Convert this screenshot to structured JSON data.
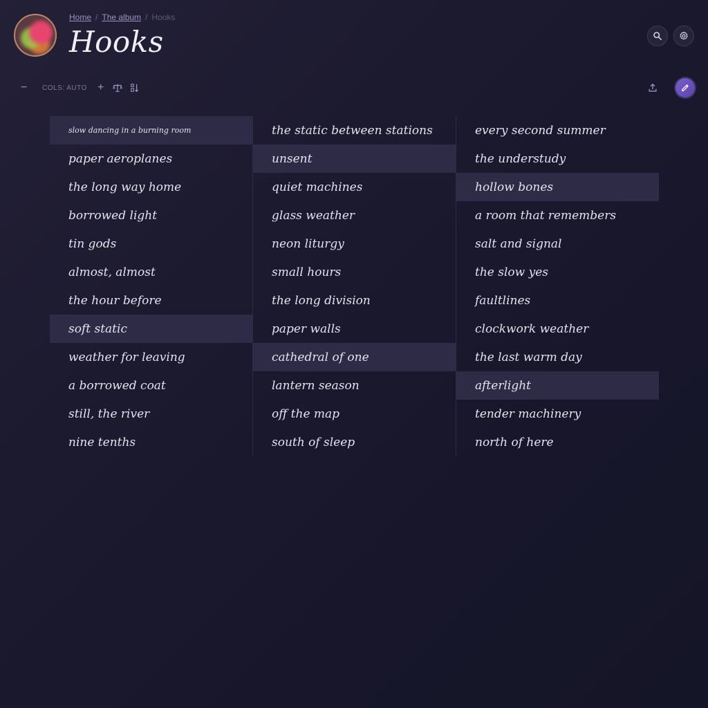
{
  "breadcrumb": {
    "home": "Home",
    "album": "The album",
    "current": "Hooks",
    "separator": "/"
  },
  "page_title": "Hooks",
  "toolbar": {
    "minus": "−",
    "cols_label": "COLS: AUTO",
    "plus": "+"
  },
  "icons": {
    "search": "search-icon",
    "settings": "gear-icon",
    "balance": "balance-icon",
    "sort": "sort-icon",
    "upload": "upload-icon",
    "edit": "pencil-icon"
  },
  "colors": {
    "accent": "#6a50c0",
    "highlight_row": "#2e2b47",
    "background": "#1c1a2e"
  },
  "columns": [
    {
      "items": [
        {
          "label": "slow dancing in a burning room",
          "highlighted": true
        },
        {
          "label": "paper aeroplanes",
          "highlighted": false
        },
        {
          "label": "the long way home",
          "highlighted": false
        },
        {
          "label": "borrowed light",
          "highlighted": false
        },
        {
          "label": "tin gods",
          "highlighted": false
        },
        {
          "label": "almost, almost",
          "highlighted": false
        },
        {
          "label": "the hour before",
          "highlighted": false
        },
        {
          "label": "soft static",
          "highlighted": true
        },
        {
          "label": "weather for leaving",
          "highlighted": false
        },
        {
          "label": "a borrowed coat",
          "highlighted": false
        },
        {
          "label": "still, the river",
          "highlighted": false
        },
        {
          "label": "nine tenths",
          "highlighted": false
        }
      ]
    },
    {
      "items": [
        {
          "label": "the static between stations",
          "highlighted": false
        },
        {
          "label": "unsent",
          "highlighted": true
        },
        {
          "label": "quiet machines",
          "highlighted": false
        },
        {
          "label": "glass weather",
          "highlighted": false
        },
        {
          "label": "neon liturgy",
          "highlighted": false
        },
        {
          "label": "small hours",
          "highlighted": false
        },
        {
          "label": "the long division",
          "highlighted": false
        },
        {
          "label": "paper walls",
          "highlighted": false
        },
        {
          "label": "cathedral of one",
          "highlighted": true
        },
        {
          "label": "lantern season",
          "highlighted": false
        },
        {
          "label": "off the map",
          "highlighted": false
        },
        {
          "label": "south of sleep",
          "highlighted": false
        }
      ]
    },
    {
      "items": [
        {
          "label": "every second summer",
          "highlighted": false
        },
        {
          "label": "the understudy",
          "highlighted": false
        },
        {
          "label": "hollow bones",
          "highlighted": true
        },
        {
          "label": "a room that remembers",
          "highlighted": false
        },
        {
          "label": "salt and signal",
          "highlighted": false
        },
        {
          "label": "the slow yes",
          "highlighted": false
        },
        {
          "label": "faultlines",
          "highlighted": false
        },
        {
          "label": "clockwork weather",
          "highlighted": false
        },
        {
          "label": "the last warm day",
          "highlighted": false
        },
        {
          "label": "afterlight",
          "highlighted": true
        },
        {
          "label": "tender machinery",
          "highlighted": false
        },
        {
          "label": "north of here",
          "highlighted": false
        }
      ]
    }
  ]
}
